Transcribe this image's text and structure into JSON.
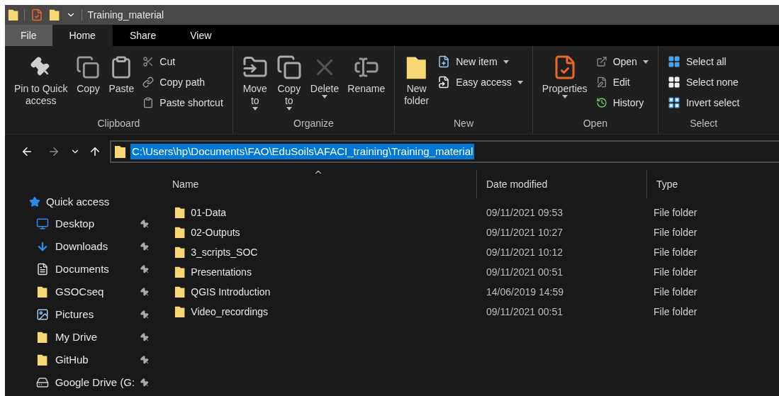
{
  "window": {
    "title": "Training_material"
  },
  "tabs": [
    {
      "label": "File",
      "kind": "file",
      "selected": false
    },
    {
      "label": "Home",
      "kind": "tab",
      "selected": true
    },
    {
      "label": "Share",
      "kind": "tab",
      "selected": false
    },
    {
      "label": "View",
      "kind": "tab",
      "selected": false
    }
  ],
  "ribbon": {
    "groups": [
      {
        "label": "Clipboard",
        "items": [
          {
            "label": "Pin to Quick\naccess",
            "kind": "large",
            "dropdown": false
          },
          {
            "label": "Copy",
            "kind": "large",
            "dropdown": false
          },
          {
            "label": "Paste",
            "kind": "large",
            "dropdown": false
          },
          {
            "label": "Cut",
            "kind": "small",
            "dropdown": false
          },
          {
            "label": "Copy path",
            "kind": "small",
            "dropdown": false
          },
          {
            "label": "Paste shortcut",
            "kind": "small",
            "dropdown": false
          }
        ]
      },
      {
        "label": "Organize",
        "items": [
          {
            "label": "Move\nto",
            "kind": "large",
            "dropdown": true
          },
          {
            "label": "Copy\nto",
            "kind": "large",
            "dropdown": true
          },
          {
            "label": "Delete",
            "kind": "large",
            "dropdown": true
          },
          {
            "label": "Rename",
            "kind": "large",
            "dropdown": false
          }
        ]
      },
      {
        "label": "New",
        "items": [
          {
            "label": "New\nfolder",
            "kind": "large",
            "dropdown": false
          },
          {
            "label": "New item",
            "kind": "small",
            "dropdown": true
          },
          {
            "label": "Easy access",
            "kind": "small",
            "dropdown": true
          }
        ]
      },
      {
        "label": "Open",
        "items": [
          {
            "label": "Properties",
            "kind": "large",
            "dropdown": true
          },
          {
            "label": "Open",
            "kind": "small",
            "dropdown": true
          },
          {
            "label": "Edit",
            "kind": "small",
            "dropdown": false
          },
          {
            "label": "History",
            "kind": "small",
            "dropdown": false
          }
        ]
      },
      {
        "label": "Select",
        "items": [
          {
            "label": "Select all",
            "kind": "small",
            "dropdown": false
          },
          {
            "label": "Select none",
            "kind": "small",
            "dropdown": false
          },
          {
            "label": "Invert select",
            "kind": "small",
            "dropdown": false
          }
        ]
      }
    ]
  },
  "address": {
    "path": "C:\\Users\\hp\\Documents\\FAO\\EduSoils\\AFACI_training\\Training_material",
    "selected": true
  },
  "sidebar": {
    "items": [
      {
        "label": "Quick access",
        "expanded": true,
        "children": [
          {
            "label": "Desktop",
            "pinned": true
          },
          {
            "label": "Downloads",
            "pinned": true
          },
          {
            "label": "Documents",
            "pinned": true
          },
          {
            "label": "GSOCseq",
            "pinned": true
          },
          {
            "label": "Pictures",
            "pinned": true
          },
          {
            "label": "My Drive",
            "pinned": true
          },
          {
            "label": "GitHub",
            "pinned": true
          },
          {
            "label": "Google Drive (G:",
            "pinned": true
          }
        ]
      }
    ]
  },
  "table": {
    "columns": [
      {
        "label": "Name",
        "sorted": true
      },
      {
        "label": "Date modified",
        "sorted": false
      },
      {
        "label": "Type",
        "sorted": false
      }
    ],
    "rows": [
      {
        "name": "01-Data",
        "date": "09/11/2021 09:53",
        "type": "File folder"
      },
      {
        "name": "02-Outputs",
        "date": "09/11/2021 10:27",
        "type": "File folder"
      },
      {
        "name": "3_scripts_SOC",
        "date": "09/11/2021 10:12",
        "type": "File folder"
      },
      {
        "name": "Presentations",
        "date": "09/11/2021 00:51",
        "type": "File folder"
      },
      {
        "name": "QGIS Introduction",
        "date": "14/06/2019 14:59",
        "type": "File folder"
      },
      {
        "name": "Video_recordings",
        "date": "09/11/2021 00:51",
        "type": "File folder"
      }
    ]
  }
}
